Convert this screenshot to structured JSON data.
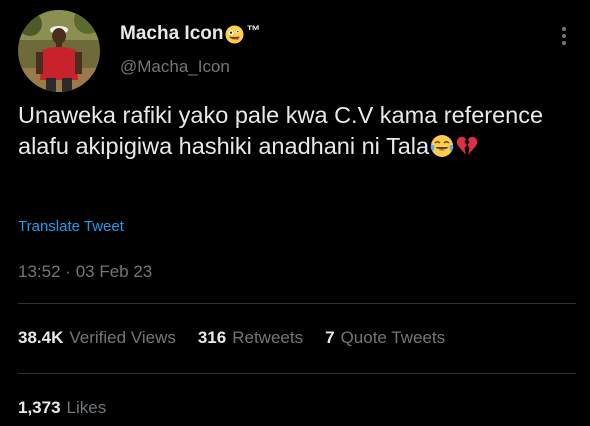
{
  "author": {
    "display_name": "Macha Icon",
    "display_name_emoji": "zany-face-emoji",
    "trademark": "™",
    "handle": "@Macha_Icon"
  },
  "tweet": {
    "text": "Unaweka rafiki yako pale kwa C.V kama reference alafu akipigiwa hashiki anadhani ni Tala",
    "trailing_emojis": [
      "tears-of-joy-emoji",
      "broken-heart-emoji"
    ],
    "translate_label": "Translate Tweet",
    "time": "13:52",
    "separator": "·",
    "date": "03 Feb 23"
  },
  "stats": {
    "views_count": "38.4K",
    "views_label": "Verified Views",
    "retweets_count": "316",
    "retweets_label": "Retweets",
    "quotes_count": "7",
    "quotes_label": "Quote Tweets",
    "likes_count": "1,373",
    "likes_label": "Likes"
  },
  "colors": {
    "background": "#000000",
    "primary_text": "#e7e9ea",
    "secondary_text": "#71767b",
    "link": "#1d9bf0",
    "divider": "#2f3336"
  }
}
